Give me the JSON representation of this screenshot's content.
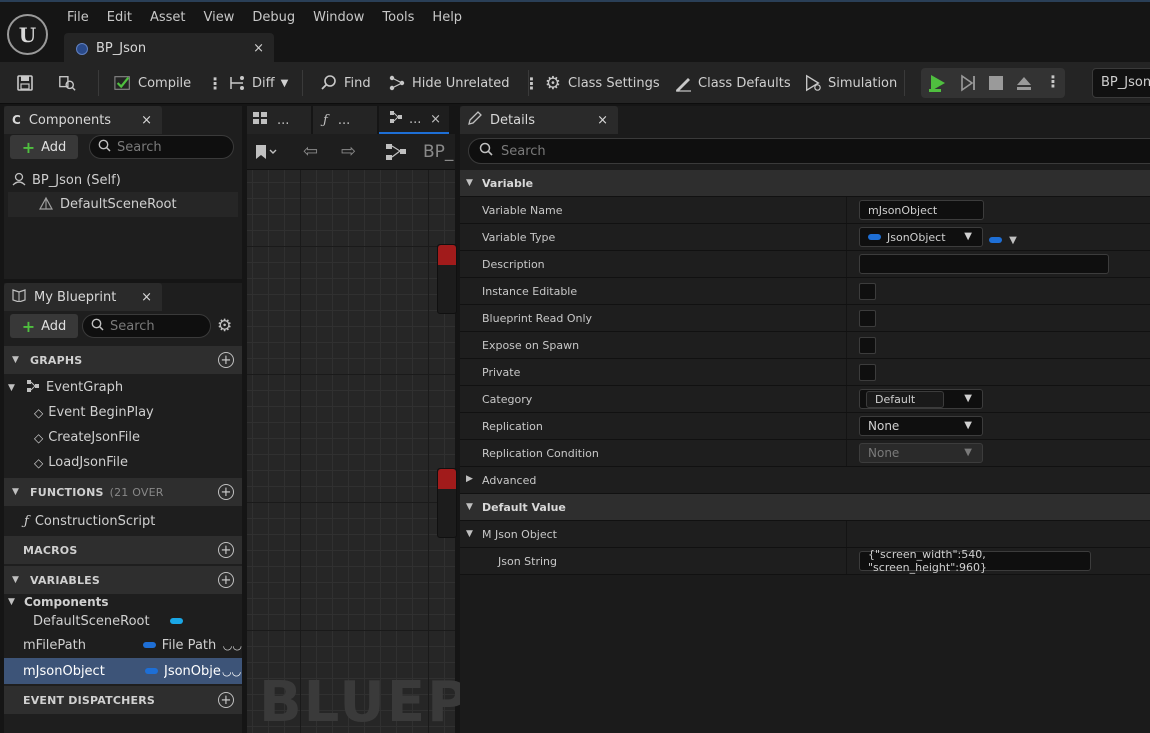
{
  "menu": [
    "File",
    "Edit",
    "Asset",
    "View",
    "Debug",
    "Window",
    "Tools",
    "Help"
  ],
  "document_tab": {
    "label": "BP_Json",
    "close": "×"
  },
  "toolbar": {
    "compile": "Compile",
    "diff": "Diff",
    "find": "Find",
    "hide_unrelated": "Hide Unrelated",
    "class_settings": "Class Settings",
    "class_defaults": "Class Defaults",
    "simulation": "Simulation",
    "bp_name": "BP_Json"
  },
  "components": {
    "tab": "Components",
    "close": "×",
    "add": "Add",
    "search_placeholder": "Search",
    "self": "BP_Json (Self)",
    "root": "DefaultSceneRoot"
  },
  "my_blueprint": {
    "tab": "My Blueprint",
    "close": "×",
    "add": "Add",
    "search_placeholder": "Search",
    "graphs_label": "GRAPHS",
    "event_graph": "EventGraph",
    "events": [
      "Event BeginPlay",
      "CreateJsonFile",
      "LoadJsonFile"
    ],
    "functions_label": "FUNCTIONS",
    "functions_note": "(21 OVER",
    "construction": "ConstructionScript",
    "macros_label": "MACROS",
    "variables_label": "VARIABLES",
    "components_group": "Components",
    "component_var": "DefaultSceneRoot",
    "var1": {
      "name": "mFilePath",
      "type": "File Path"
    },
    "var2": {
      "name": "mJsonObject",
      "type": "JsonObje"
    },
    "dispatchers_label": "EVENT DISPATCHERS"
  },
  "graph_tabs": [
    "...",
    "...",
    "..."
  ],
  "graph": {
    "breadcrumb": "BP_",
    "watermark": "BLUEPF"
  },
  "details": {
    "tab": "Details",
    "close": "×",
    "search_placeholder": "Search",
    "variable_section": "Variable",
    "variable_name_label": "Variable Name",
    "variable_name": "mJsonObject",
    "variable_type_label": "Variable Type",
    "variable_type": "JsonObject",
    "description_label": "Description",
    "instance_editable_label": "Instance Editable",
    "bp_readonly_label": "Blueprint Read Only",
    "expose_label": "Expose on Spawn",
    "private_label": "Private",
    "category_label": "Category",
    "category": "Default",
    "replication_label": "Replication",
    "replication": "None",
    "replication_condition_label": "Replication Condition",
    "replication_condition": "None",
    "advanced_label": "Advanced",
    "default_section": "Default Value",
    "m_json_object_label": "M Json Object",
    "json_string_label": "Json String",
    "json_string": "{\"screen_width\":540, \"screen_height\":960}"
  },
  "colors": {
    "accent_blue": "#1e6fd6",
    "var_cyan": "#1aa7e6",
    "selected_row": "#3d5478",
    "play_green": "#4fbf3f"
  }
}
